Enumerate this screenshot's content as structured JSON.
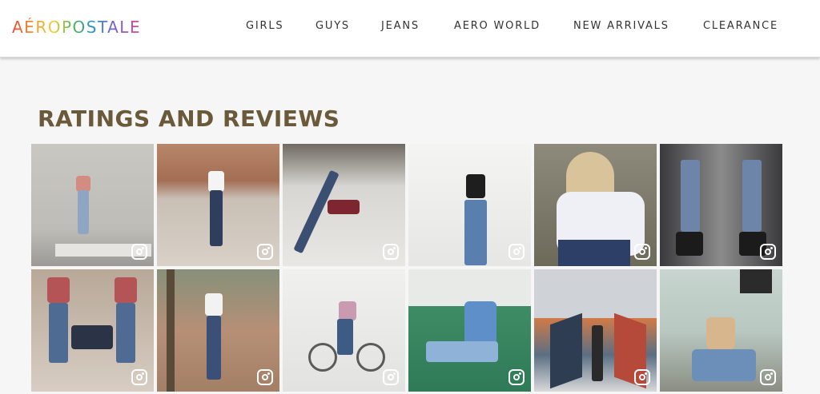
{
  "brand": {
    "logo_text": "AÉROPOSTALE"
  },
  "nav": {
    "items": [
      {
        "label": "GIRLS"
      },
      {
        "label": "GUYS"
      },
      {
        "label": "JEANS"
      },
      {
        "label": "AERO WORLD"
      },
      {
        "label": "NEW ARRIVALS"
      },
      {
        "label": "CLEARANCE"
      }
    ]
  },
  "reviews": {
    "title": "RATINGS AND REVIEWS",
    "tile_icon": "instagram-icon",
    "tiles": [
      {
        "scene": "girl in red top and jeans posing against concrete wall"
      },
      {
        "scene": "girl in white tee and jeans in plaza"
      },
      {
        "scene": "girl in maroon top doing leg kick in store"
      },
      {
        "scene": "girl in black crop top against white brick wall"
      },
      {
        "scene": "blonde girl in floral top"
      },
      {
        "scene": "mirrored photo of jeans and black boots"
      },
      {
        "scene": "mirrored photo of girl in striped top and jeans"
      },
      {
        "scene": "girl in white tee and jeans beside tree"
      },
      {
        "scene": "girl in pink top riding a bicycle"
      },
      {
        "scene": "girl in denim shirt sitting on green steps"
      },
      {
        "scene": "girl in jeans in front of geometric mural"
      },
      {
        "scene": "girl in jeans sitting in chair indoors"
      }
    ]
  }
}
